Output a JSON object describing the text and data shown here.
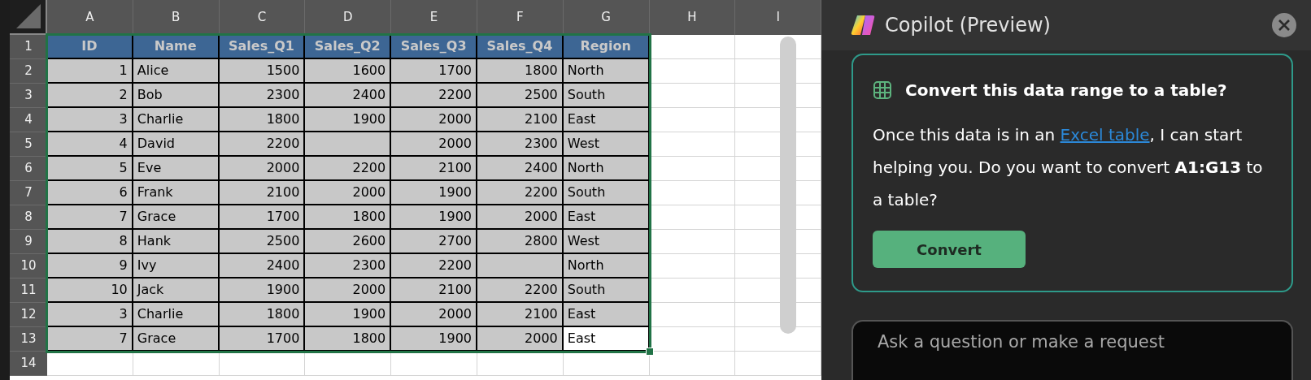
{
  "sheet": {
    "columns": [
      "A",
      "B",
      "C",
      "D",
      "E",
      "F",
      "G",
      "H",
      "I"
    ],
    "header_row": {
      "number": "1",
      "cells": [
        "ID",
        "Name",
        "Sales_Q1",
        "Sales_Q2",
        "Sales_Q3",
        "Sales_Q4",
        "Region"
      ]
    },
    "rows": [
      {
        "number": "2",
        "cells": [
          "1",
          "Alice",
          "1500",
          "1600",
          "1700",
          "1800",
          "North"
        ],
        "active": false
      },
      {
        "number": "3",
        "cells": [
          "2",
          "Bob",
          "2300",
          "2400",
          "2200",
          "2500",
          "South"
        ],
        "active": false
      },
      {
        "number": "4",
        "cells": [
          "3",
          "Charlie",
          "1800",
          "1900",
          "2000",
          "2100",
          "East"
        ],
        "active": false
      },
      {
        "number": "5",
        "cells": [
          "4",
          "David",
          "2200",
          null,
          "2000",
          "2300",
          "West"
        ],
        "active": false
      },
      {
        "number": "6",
        "cells": [
          "5",
          "Eve",
          "2000",
          "2200",
          "2100",
          "2400",
          "North"
        ],
        "active": false
      },
      {
        "number": "7",
        "cells": [
          "6",
          "Frank",
          "2100",
          "2000",
          "1900",
          "2200",
          "South"
        ],
        "active": false
      },
      {
        "number": "8",
        "cells": [
          "7",
          "Grace",
          "1700",
          "1800",
          "1900",
          "2000",
          "East"
        ],
        "active": false
      },
      {
        "number": "9",
        "cells": [
          "8",
          "Hank",
          "2500",
          "2600",
          "2700",
          "2800",
          "West"
        ],
        "active": false
      },
      {
        "number": "10",
        "cells": [
          "9",
          "Ivy",
          "2400",
          "2300",
          "2200",
          null,
          "North"
        ],
        "active": false
      },
      {
        "number": "11",
        "cells": [
          "10",
          "Jack",
          "1900",
          "2000",
          "2100",
          "2200",
          "South"
        ],
        "active": false
      },
      {
        "number": "12",
        "cells": [
          "3",
          "Charlie",
          "1800",
          "1900",
          "2000",
          "2100",
          "East"
        ],
        "active": false
      },
      {
        "number": "13",
        "cells": [
          "7",
          "Grace",
          "1700",
          "1800",
          "1900",
          "2000",
          "East"
        ],
        "active": true
      }
    ],
    "empty_rows": [
      "14"
    ]
  },
  "copilot": {
    "title": "Copilot (Preview)",
    "card": {
      "heading": "Convert this data range to a table?",
      "text_before": "Once this data is in an ",
      "link": "Excel table",
      "text_after": ", I can start helping you. Do you want to convert **A1:G13** to a table?",
      "button": "Convert"
    },
    "input": {
      "placeholder": "Ask a question or make a request"
    }
  }
}
